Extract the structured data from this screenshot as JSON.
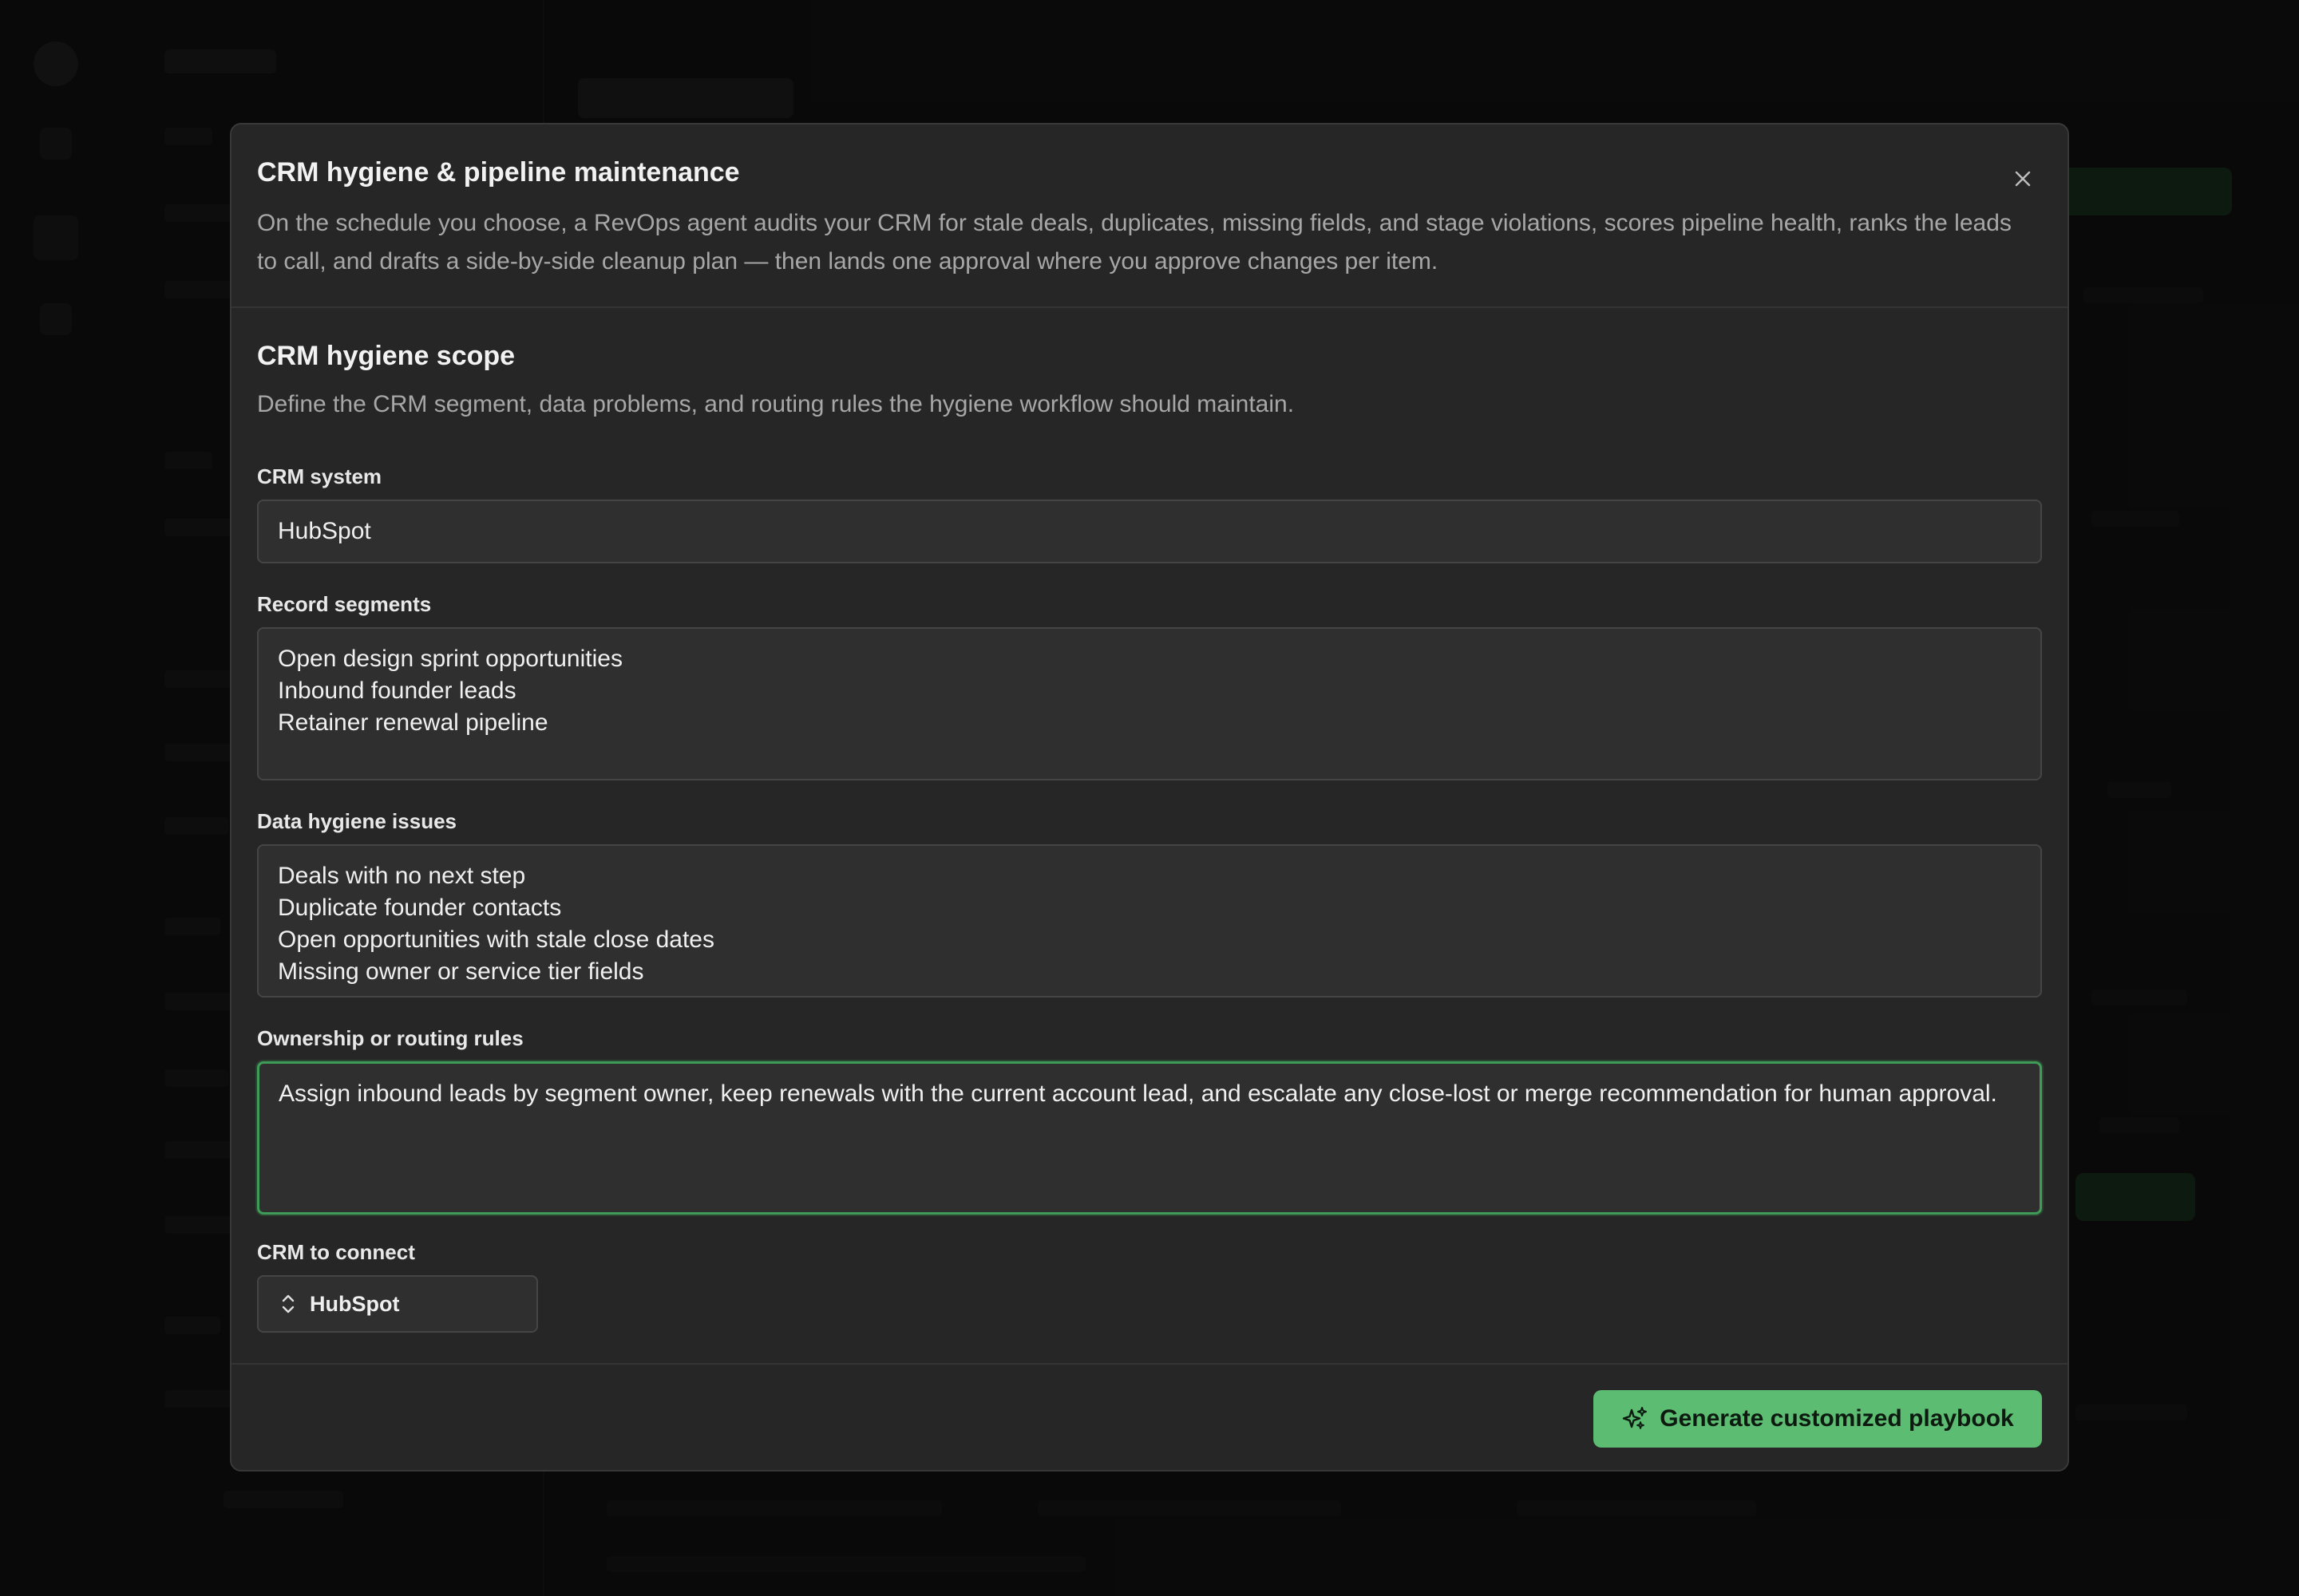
{
  "modal": {
    "title": "CRM hygiene & pipeline maintenance",
    "description": "On the schedule you choose, a RevOps agent audits your CRM for stale deals, duplicates, missing fields, and stage violations, scores pipeline health, ranks the leads to call, and drafts a side-by-side cleanup plan — then lands one approval where you approve changes per item.",
    "close_icon": "close-icon"
  },
  "section": {
    "title": "CRM hygiene scope",
    "description": "Define the CRM segment, data problems, and routing rules the hygiene workflow should maintain."
  },
  "fields": {
    "crm_system": {
      "label": "CRM system",
      "value": "HubSpot"
    },
    "record_segments": {
      "label": "Record segments",
      "value": "Open design sprint opportunities\nInbound founder leads\nRetainer renewal pipeline"
    },
    "data_hygiene_issues": {
      "label": "Data hygiene issues",
      "value": "Deals with no next step\nDuplicate founder contacts\nOpen opportunities with stale close dates\nMissing owner or service tier fields"
    },
    "ownership_rules": {
      "label": "Ownership or routing rules",
      "value": "Assign inbound leads by segment owner, keep renewals with the current account lead, and escalate any close-lost or merge recommendation for human approval."
    },
    "crm_to_connect": {
      "label": "CRM to connect",
      "selected": "HubSpot",
      "icon": "chevron-up-down-icon"
    }
  },
  "footer": {
    "generate_label": "Generate customized playbook",
    "generate_icon": "sparkles-icon"
  },
  "colors": {
    "accent": "#5cbc71",
    "focus_border": "#3f9b58",
    "modal_bg": "#262626",
    "field_bg": "#2f2f2f"
  }
}
